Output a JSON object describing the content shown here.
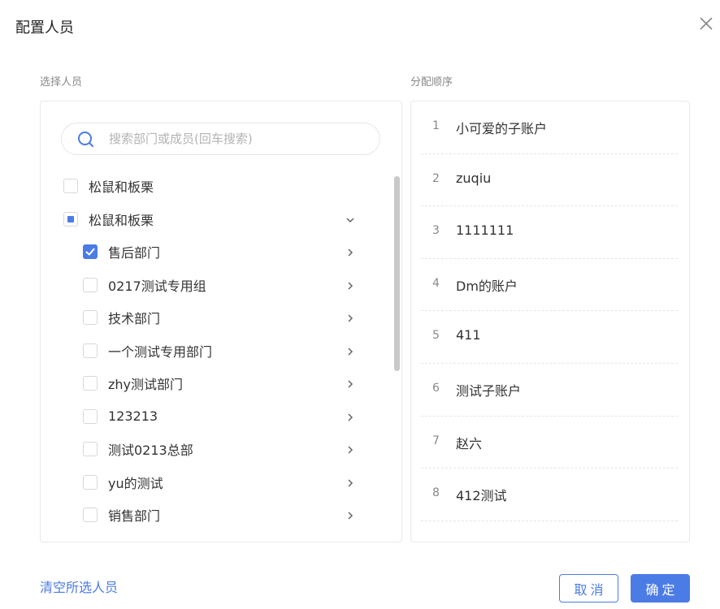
{
  "dialog": {
    "title": "配置人员",
    "close_icon": "close-icon"
  },
  "left": {
    "label": "选择人员",
    "search": {
      "placeholder": "搜索部门或成员(回车搜索)",
      "value": ""
    },
    "tree": [
      {
        "label": "松鼠和板栗",
        "level": 0,
        "state": "unchecked",
        "arrow": ""
      },
      {
        "label": "松鼠和板栗",
        "level": 0,
        "state": "partial",
        "arrow": "chevron-down-icon"
      },
      {
        "label": "售后部门",
        "level": 1,
        "state": "checked",
        "arrow": "chevron-right-icon"
      },
      {
        "label": "0217测试专用组",
        "level": 1,
        "state": "unchecked",
        "arrow": "chevron-right-icon"
      },
      {
        "label": "技术部门",
        "level": 1,
        "state": "unchecked",
        "arrow": "chevron-right-icon"
      },
      {
        "label": "一个测试专用部门",
        "level": 1,
        "state": "unchecked",
        "arrow": "chevron-right-icon"
      },
      {
        "label": "zhy测试部门",
        "level": 1,
        "state": "unchecked",
        "arrow": "chevron-right-icon"
      },
      {
        "label": "123213",
        "level": 1,
        "state": "unchecked",
        "arrow": "chevron-right-icon"
      },
      {
        "label": "测试0213总部",
        "level": 1,
        "state": "unchecked",
        "arrow": "chevron-right-icon"
      },
      {
        "label": "yu的测试",
        "level": 1,
        "state": "unchecked",
        "arrow": "chevron-right-icon"
      },
      {
        "label": "销售部门",
        "level": 1,
        "state": "unchecked",
        "arrow": "chevron-right-icon"
      }
    ]
  },
  "right": {
    "label": "分配顺序",
    "items": [
      {
        "num": "1",
        "name": "小可爱的子账户"
      },
      {
        "num": "2",
        "name": "zuqiu"
      },
      {
        "num": "3",
        "name": "1111111"
      },
      {
        "num": "4",
        "name": "Dm的账户"
      },
      {
        "num": "5",
        "name": "411"
      },
      {
        "num": "6",
        "name": "测试子账户"
      },
      {
        "num": "7",
        "name": "赵六"
      },
      {
        "num": "8",
        "name": "412测试"
      }
    ]
  },
  "footer": {
    "clear_label": "清空所选人员",
    "cancel_label": "取消",
    "ok_label": "确定"
  },
  "colors": {
    "accent": "#4b7be5",
    "border": "#e6e9f0"
  }
}
